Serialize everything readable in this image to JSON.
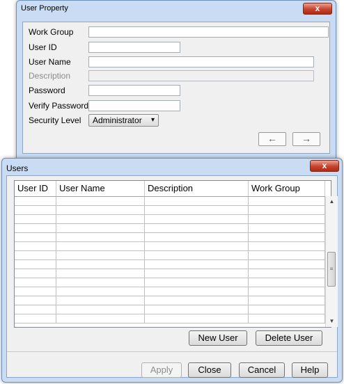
{
  "user_property": {
    "title": "User Property",
    "close": "x",
    "fields": {
      "work_group_label": "Work Group",
      "user_id_label": "User ID",
      "user_name_label": "User Name",
      "description_label": "Description",
      "password_label": "Password",
      "verify_password_label": "Verify Password",
      "security_level_label": "Security Level",
      "work_group_value": "",
      "user_id_value": "",
      "user_name_value": "",
      "description_value": "",
      "password_value": "",
      "verify_password_value": "",
      "security_level_value": "Administrator",
      "security_level_arrow": "▾"
    },
    "nav": {
      "prev": "←",
      "next": "→"
    }
  },
  "users": {
    "title": "Users",
    "close": "x",
    "columns": [
      "User ID",
      "User Name",
      "Description",
      "Work Group"
    ],
    "row_count": 14,
    "scroll": {
      "up": "▲",
      "down": "▼",
      "grip": "≡"
    },
    "buttons": {
      "new_user": "New User",
      "delete_user": "Delete User",
      "apply": "Apply",
      "close": "Close",
      "cancel": "Cancel",
      "help": "Help"
    }
  }
}
